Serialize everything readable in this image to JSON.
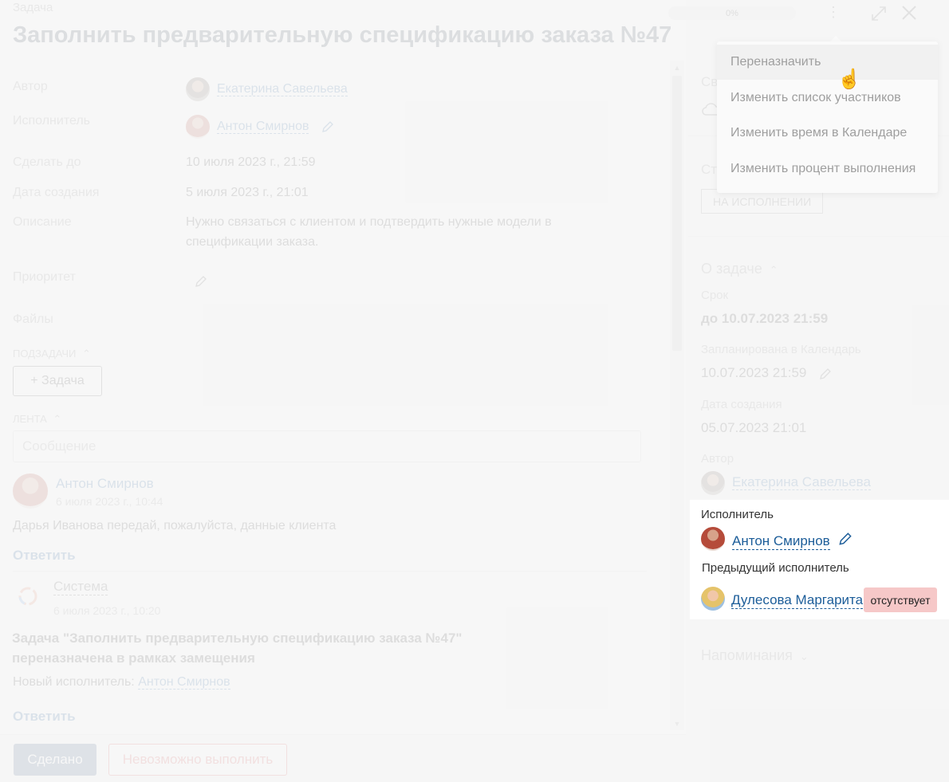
{
  "header": {
    "breadcrumb": "Задача",
    "title": "Заполнить предварительную спецификацию заказа №47",
    "progress": "0%"
  },
  "details": {
    "author_label": "Автор",
    "author_name": "Екатерина Савельева",
    "assignee_label": "Исполнитель",
    "assignee_name": "Антон Смирнов",
    "due_label": "Сделать до",
    "due_value": "10 июля 2023 г., 21:59",
    "created_label": "Дата создания",
    "created_value": "5 июля 2023 г., 21:01",
    "description_label": "Описание",
    "description_line1": "Нужно связаться с клиентом и подтвердить нужные модели в",
    "description_line2": "спецификации заказа.",
    "priority_label": "Приоритет",
    "files_label": "Файлы"
  },
  "subtasks": {
    "heading": "ПОДЗАДАЧИ",
    "add_button": "+ Задача"
  },
  "feed": {
    "heading": "ЛЕНТА",
    "message_placeholder": "Сообщение",
    "comments": [
      {
        "author": "Антон Смирнов",
        "date": "6 июля 2023 г., 10:44",
        "text": "Дарья Иванова передай, пожалуйста, данные клиента",
        "reply": "Ответить"
      },
      {
        "author": "Система",
        "date": "6 июля 2023 г., 10:20",
        "text_line1": "Задача \"Заполнить предварительную спецификацию заказа №47\"",
        "text_line2": "переназначена в рамках замещения",
        "new_assignee_label": "Новый исполнитель:",
        "new_assignee": "Антон Смирнов",
        "reply": "Ответить"
      }
    ]
  },
  "footer": {
    "done_button": "Сделано",
    "fail_button": "Невозможно выполнить"
  },
  "sidebar": {
    "connection_label_partial": "Св",
    "status_label_partial": "Ст",
    "status_value": "НА ИСПОЛНЕНИИ",
    "about_heading": "О задаче",
    "deadline_label": "Срок",
    "deadline_value": "до 10.07.2023 21:59",
    "calendar_label": "Запланирована в Календарь",
    "calendar_value": "10.07.2023 21:59",
    "created_label": "Дата создания",
    "created_value": "05.07.2023 21:01",
    "author_label": "Автор",
    "author_name": "Екатерина Савельева",
    "assignee_label": "Исполнитель",
    "assignee_name": "Антон Смирнов",
    "prev_assignee_label": "Предыдущий исполнитель",
    "prev_assignee_name": "Дулесова Маргарита",
    "absent_badge": "отсутствует",
    "reminders_heading": "Напоминания"
  },
  "menu": {
    "items": [
      "Переназначить",
      "Изменить список участников",
      "Изменить время в Календаре",
      "Изменить процент выполнения"
    ]
  },
  "icons": {
    "pencil": "pencil-icon",
    "more": "more-vertical-icon",
    "expand": "expand-icon",
    "close": "close-icon",
    "chevron_up": "chevron-up-icon",
    "chevron_down": "chevron-down-icon",
    "cloud": "cloud-icon",
    "cursor": "hand-cursor-icon"
  }
}
